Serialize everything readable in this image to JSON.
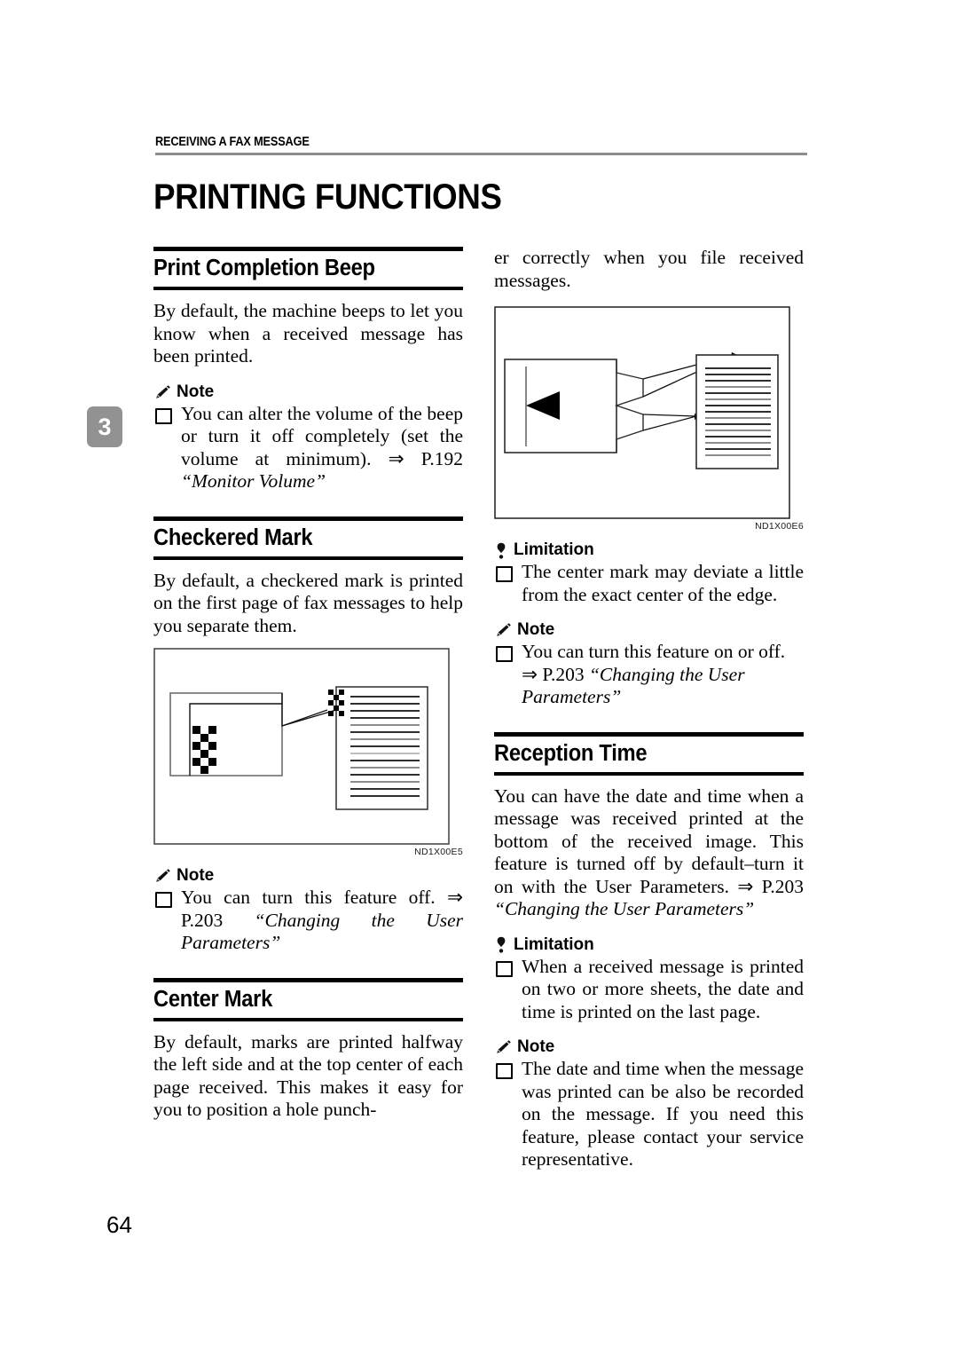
{
  "page": {
    "running_header": "RECEIVING A FAX MESSAGE",
    "chapter_title": "PRINTING FUNCTIONS",
    "chapter_tab": "3",
    "page_number": "64"
  },
  "left_column": {
    "section1": {
      "title": "Print Completion Beep",
      "paragraph": "By default, the machine beeps to let you know when a received message has been printed.",
      "note": {
        "label": "Note",
        "icon": "pencil-icon",
        "items": [
          {
            "text": "You can alter the volume of the beep or turn it off completely (set the volume at minimum). ⇒ P.192 ",
            "italic": "“Monitor Volume”"
          }
        ]
      }
    },
    "section2": {
      "title": "Checkered Mark",
      "paragraph": "By default, a checkered mark is printed on the first page of  fax messages to help you separate them.",
      "figure": {
        "name": "checkered-mark-figure",
        "label": "ND1X00E5"
      },
      "note": {
        "label": "Note",
        "icon": "pencil-icon",
        "items": [
          {
            "text": "You can turn this feature off. ⇒ P.203 ",
            "italic": "“Changing the User Parameters”"
          }
        ]
      }
    },
    "section3": {
      "title": "Center Mark",
      "paragraph": "By default, marks are printed halfway the left side and at the top center of each page received. This makes it easy for you to position a hole punch-"
    }
  },
  "right_column": {
    "continuation": "er correctly when you file received messages.",
    "figure": {
      "name": "center-mark-figure",
      "label": "ND1X00E6"
    },
    "limitation1": {
      "label": "Limitation",
      "icon": "limitation-icon",
      "items": [
        {
          "text": "The center mark may deviate a little from the exact center of the edge.",
          "italic": ""
        }
      ]
    },
    "note1": {
      "label": "Note",
      "icon": "pencil-icon",
      "items": [
        {
          "text": "You can turn this feature on or off. ⇒ P.203 ",
          "italic": "“Changing the User Parameters”"
        }
      ]
    },
    "section_reception": {
      "title": "Reception Time",
      "paragraph": "You can have the date and time when a message was received printed at the bottom of the received image. This feature is turned off by default–turn it on with the User Parameters. ⇒ P.203 ",
      "paragraph_italic": "“Changing the User Parameters”"
    },
    "limitation2": {
      "label": "Limitation",
      "icon": "limitation-icon",
      "items": [
        {
          "text": "When a received message is printed on two or more sheets, the date and time is printed on the last page.",
          "italic": ""
        }
      ]
    },
    "note2": {
      "label": "Note",
      "icon": "pencil-icon",
      "items": [
        {
          "text": "The date and time when the message was printed can be also be recorded on the message. If you need this feature, please contact your service representative.",
          "italic": ""
        }
      ]
    }
  }
}
